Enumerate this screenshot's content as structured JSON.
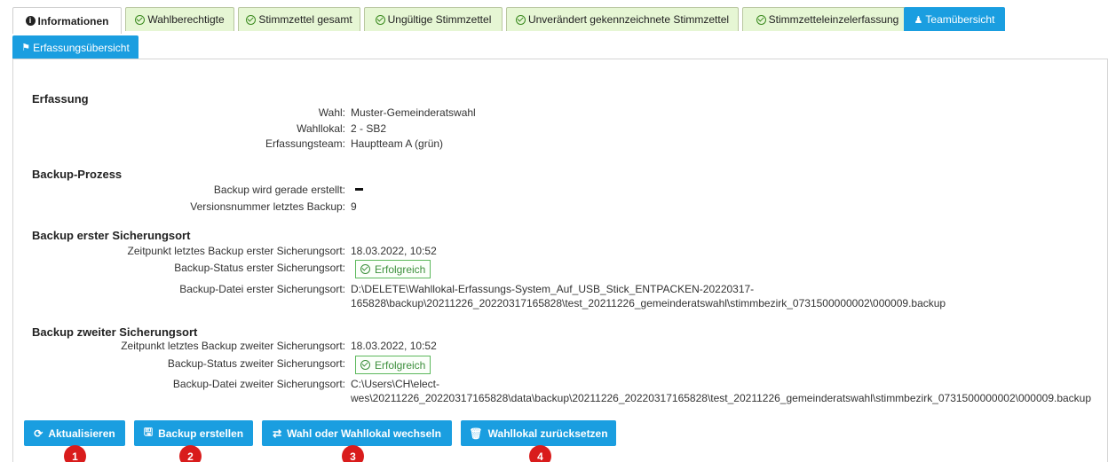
{
  "tabs": [
    {
      "label": "Informationen",
      "icon": "info-icon",
      "state": "active"
    },
    {
      "label": "Wahlberechtigte",
      "icon": "check-circle-icon",
      "state": "done"
    },
    {
      "label": "Stimmzettel gesamt",
      "icon": "check-circle-icon",
      "state": "done"
    },
    {
      "label": "Ungültige Stimmzettel",
      "icon": "check-circle-icon",
      "state": "done"
    },
    {
      "label": "Unverändert gekennzeichnete Stimmzettel",
      "icon": "check-circle-icon",
      "state": "done"
    },
    {
      "label": "Stimmzetteleinzelerfassung",
      "icon": "check-circle-icon",
      "state": "done"
    },
    {
      "label": "Teamübersicht",
      "icon": "users-icon",
      "state": "highlight"
    },
    {
      "label": "Erfassungsübersicht",
      "icon": "flag-icon",
      "state": "highlight"
    }
  ],
  "erfassung": {
    "title": "Erfassung",
    "wahl_label": "Wahl:",
    "wahl_value": "Muster-Gemeinderatswahl",
    "wahllokal_label": "Wahllokal:",
    "wahllokal_value": "2 - SB2",
    "team_label": "Erfassungsteam:",
    "team_value": "Hauptteam A (grün)"
  },
  "backup_prozess": {
    "title": "Backup-Prozess",
    "running_label": "Backup wird gerade erstellt:",
    "running_value": "–",
    "version_label": "Versionsnummer letztes Backup:",
    "version_value": "9"
  },
  "backup_erster": {
    "title": "Backup erster Sicherungsort",
    "zeit_label": "Zeitpunkt letztes Backup erster Sicherungsort:",
    "zeit_value": "18.03.2022, 10:52",
    "status_label": "Backup-Status erster Sicherungsort:",
    "status_value": "Erfolgreich",
    "datei_label": "Backup-Datei erster Sicherungsort:",
    "datei_line1": "D:\\DELETE\\Wahllokal-Erfassungs-System_Auf_USB_Stick_ENTPACKEN-20220317-",
    "datei_line2": "165828\\backup\\20211226_20220317165828\\test_20211226_gemeinderatswahl\\stimmbezirk_0731500000002\\000009.backup"
  },
  "backup_zweiter": {
    "title": "Backup zweiter Sicherungsort",
    "zeit_label": "Zeitpunkt letztes Backup zweiter Sicherungsort:",
    "zeit_value": "18.03.2022, 10:52",
    "status_label": "Backup-Status zweiter Sicherungsort:",
    "status_value": "Erfolgreich",
    "datei_label": "Backup-Datei zweiter Sicherungsort:",
    "datei_line1": "C:\\Users\\CH\\elect-",
    "datei_line2": "wes\\20211226_20220317165828\\data\\backup\\20211226_20220317165828\\test_20211226_gemeinderatswahl\\stimmbezirk_0731500000002\\000009.backup"
  },
  "buttons": {
    "refresh": "Aktualisieren",
    "backup": "Backup erstellen",
    "switch": "Wahl oder Wahllokal wechseln",
    "reset": "Wahllokal zurücksetzen"
  },
  "markers": [
    "1",
    "2",
    "3",
    "4"
  ],
  "colors": {
    "accent": "#1a9ee0",
    "tab_done": "#e6f6d4",
    "success": "#3c8f3c",
    "marker": "#d91c1c"
  }
}
